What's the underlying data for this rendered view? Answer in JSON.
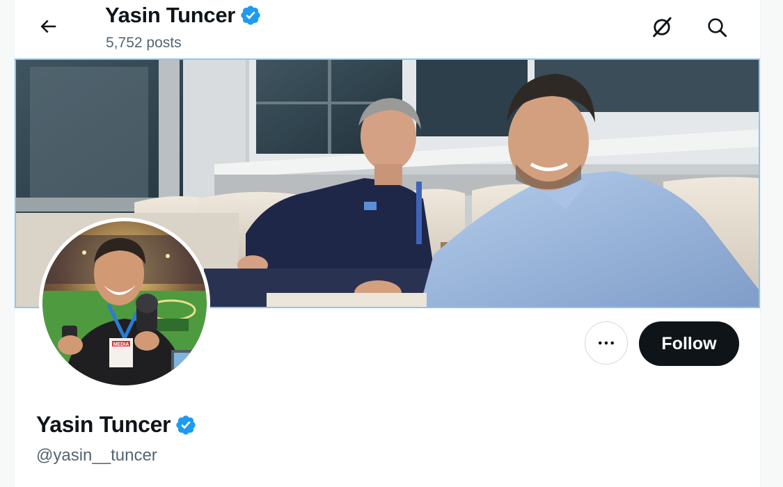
{
  "header": {
    "title": "Yasin Tuncer",
    "post_count": "5,752 posts",
    "back_icon": "arrow-left-icon",
    "grok_icon": "grok-icon",
    "search_icon": "search-icon"
  },
  "profile": {
    "display_name": "Yasin Tuncer",
    "handle": "@yasin__tuncer",
    "verified": true,
    "verified_icon": "verified-badge-icon",
    "avatar_lanyard_text": "MEDIA",
    "banner_image": "stadium-box-photo"
  },
  "actions": {
    "more_icon": "more-horizontal-icon",
    "follow_label": "Follow"
  },
  "colors": {
    "verified_blue": "#1d9bf0",
    "follow_bg": "#0f1419",
    "secondary_text": "#536471"
  }
}
